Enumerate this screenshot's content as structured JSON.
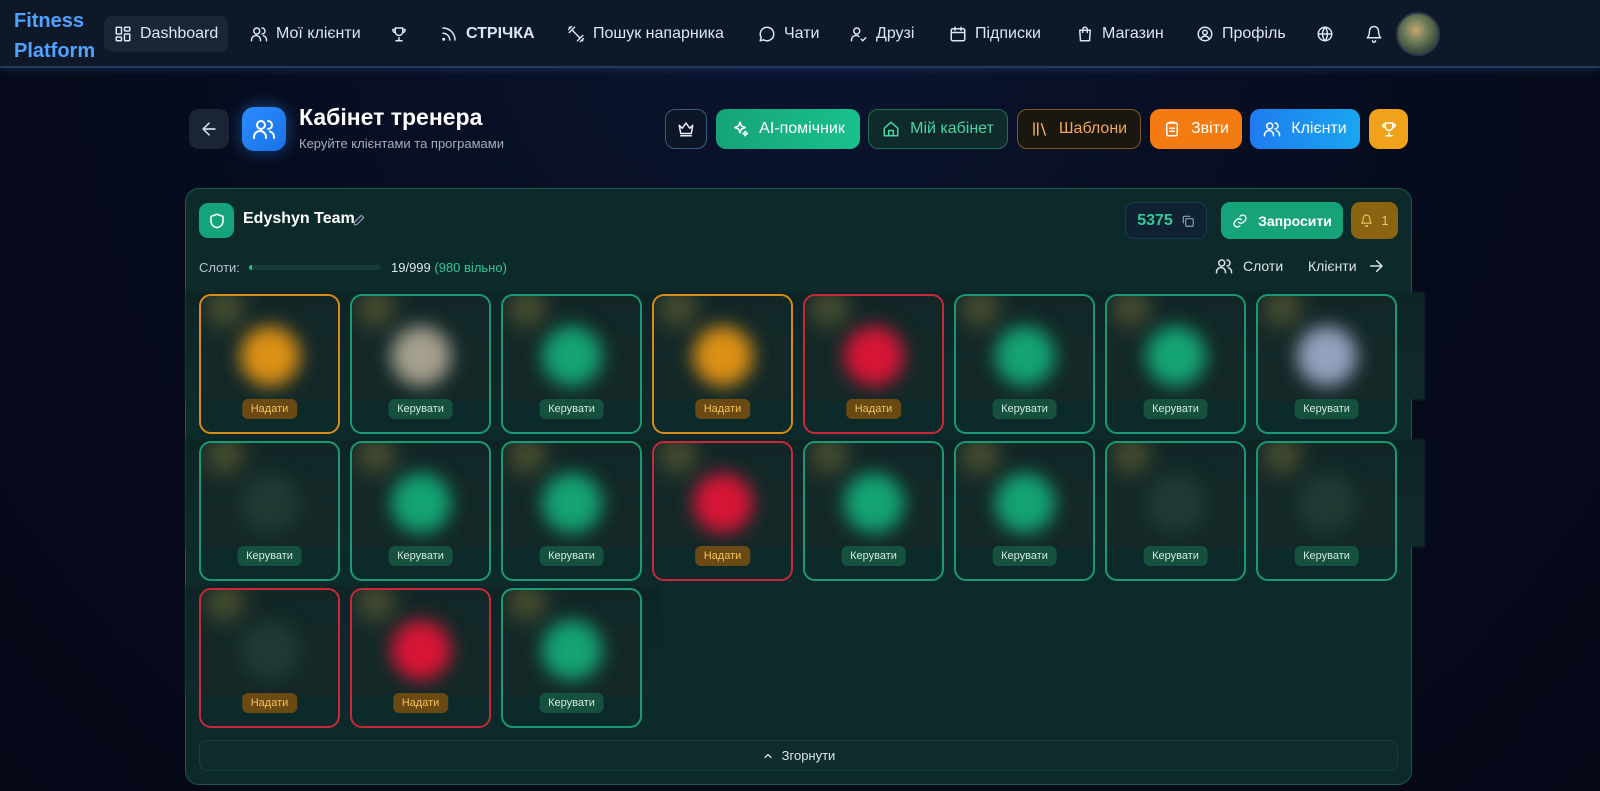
{
  "brand": {
    "logo": "Fitness Platform"
  },
  "nav": {
    "items": [
      {
        "label": "Dashboard",
        "icon": "dashboard-icon"
      },
      {
        "label": "Мої клієнти",
        "icon": "users-icon"
      },
      {
        "label": "",
        "icon": "trophy-icon"
      },
      {
        "label": "СТРІЧКА",
        "icon": "rss-icon"
      },
      {
        "label": "Пошук напарника",
        "icon": "dumbbell-icon"
      },
      {
        "label": "Чати",
        "icon": "chat-icon"
      },
      {
        "label": "Друзі",
        "icon": "user-check-icon"
      },
      {
        "label": "Підписки",
        "icon": "calendar-icon"
      },
      {
        "label": "Магазин",
        "icon": "shopping-bag-icon"
      },
      {
        "label": "Профіль",
        "icon": "user-circle-icon"
      }
    ]
  },
  "header": {
    "title": "Кабінет тренера",
    "subtitle": "Керуйте клієнтами та програмами",
    "buttons": {
      "ai": "AI-помічник",
      "cabinet": "Мій кабінет",
      "templates": "Шаблони",
      "reports": "Звіти",
      "clients": "Клієнти"
    }
  },
  "team": {
    "name": "Edyshyn Team",
    "code": "5375",
    "invite_label": "Запросити",
    "notifications": "1",
    "slots_label": "Слоти:",
    "slots_used": 19,
    "slots_total": 999,
    "slots_count_text": "19/999",
    "slots_free_text": "(980 вільно)",
    "link_slots": "Слоти",
    "link_clients": "Клієнти",
    "collapse_label": "Згорнути"
  },
  "colors": {
    "accent_green": "#17a37a",
    "accent_blue": "#1f7cf0",
    "accent_orange": "#f47a12",
    "status_red": "#c9283b",
    "status_orange": "#d98b16"
  },
  "clients": [
    {
      "status": "orange",
      "action": "Надати",
      "avatar": "orange"
    },
    {
      "status": "green",
      "action": "Керувати",
      "avatar": "gray"
    },
    {
      "status": "green",
      "action": "Керувати",
      "avatar": "green"
    },
    {
      "status": "orange",
      "action": "Надати",
      "avatar": "orange"
    },
    {
      "status": "red",
      "action": "Надати",
      "avatar": "red"
    },
    {
      "status": "green",
      "action": "Керувати",
      "avatar": "green"
    },
    {
      "status": "green",
      "action": "Керувати",
      "avatar": "green"
    },
    {
      "status": "green",
      "action": "Керувати",
      "avatar": "slate"
    },
    {
      "status": "green",
      "action": "Керувати",
      "avatar": "none"
    },
    {
      "status": "green",
      "action": "Керувати",
      "avatar": "green"
    },
    {
      "status": "green",
      "action": "Керувати",
      "avatar": "green"
    },
    {
      "status": "red",
      "action": "Надати",
      "avatar": "red"
    },
    {
      "status": "green",
      "action": "Керувати",
      "avatar": "green"
    },
    {
      "status": "green",
      "action": "Керувати",
      "avatar": "green"
    },
    {
      "status": "green",
      "action": "Керувати",
      "avatar": "none"
    },
    {
      "status": "green",
      "action": "Керувати",
      "avatar": "none"
    },
    {
      "status": "red",
      "action": "Надати",
      "avatar": "none"
    },
    {
      "status": "red",
      "action": "Надати",
      "avatar": "red"
    },
    {
      "status": "green",
      "action": "Керувати",
      "avatar": "green"
    }
  ]
}
